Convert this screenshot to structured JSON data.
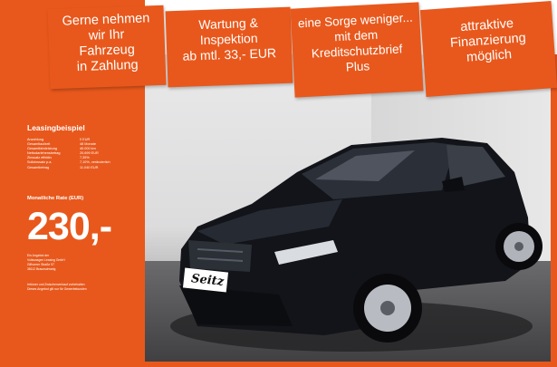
{
  "banners": [
    {
      "line1": "Gerne nehmen",
      "line2": "wir Ihr",
      "line3": "Fahrzeug",
      "line4": "in Zahlung"
    },
    {
      "line1": "Wartung &",
      "line2": "Inspektion",
      "line3": "ab mtl. 33,- EUR"
    },
    {
      "line1": "eine Sorge weniger...",
      "line2": "mit dem",
      "line3": "Kreditschutzbrief",
      "line4": "Plus"
    },
    {
      "line1": "attraktive",
      "line2": "Finanzierung",
      "line3": "möglich"
    }
  ],
  "leasing": {
    "title": "Leasingbeispiel",
    "rows": [
      {
        "label": "Anzahlung",
        "value": "0 EUR"
      },
      {
        "label": "Gesamtlaufzeit",
        "value": "48 Monate"
      },
      {
        "label": "Gesamtfahrleistung",
        "value": "40.000 km"
      },
      {
        "label": "Nettodarlehensbetrag",
        "value": "20.699 EUR"
      },
      {
        "label": "Zinssatz effektiv",
        "value": "7,35%"
      },
      {
        "label": "Sollzinssatz p.a.",
        "value": "7,10%, veränderlich"
      },
      {
        "label": "Gesamtbetrag",
        "value": "11.040 EUR"
      }
    ],
    "monthly_label": "Monatliche Rate (EUR)",
    "monthly_value": "230,-",
    "provider": {
      "line1": "Ein Angebot der",
      "line2": "Volkswagen Leasing GmbH",
      "line3": "Gifhorner Straße 57",
      "line4": "38112 Braunschweig"
    },
    "disclaimer": {
      "line1": "Irrtümer und Zwischenverkauf vorbehalten",
      "line2": "Dieses Angebot gilt nur für Gewerbekunden"
    }
  },
  "car": {
    "plate_text": "Seitz"
  },
  "colors": {
    "accent": "#e8581c",
    "car_body": "#121419"
  }
}
